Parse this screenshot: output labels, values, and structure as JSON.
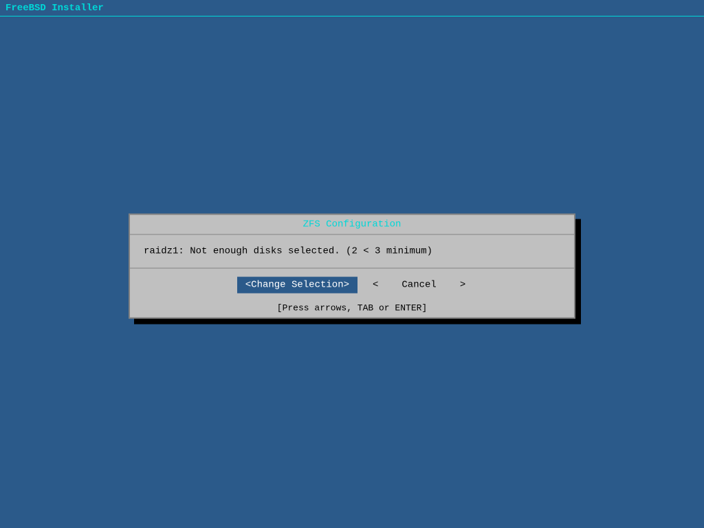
{
  "titlebar": {
    "label": "FreeBSD Installer"
  },
  "dialog": {
    "title": "ZFS Configuration",
    "message": "raidz1: Not enough disks selected. (2 < 3 minimum)",
    "btn_change_selection": "<Change Selection>",
    "btn_left_arrow": "<",
    "btn_cancel": "Cancel",
    "btn_right_arrow": ">",
    "hint": "[Press arrows, TAB or ENTER]"
  },
  "colors": {
    "background": "#2b5a8a",
    "title_color": "#00d7d7",
    "dialog_bg": "#c0c0c0",
    "selected_btn_bg": "#2b5a8a",
    "selected_btn_fg": "#ffffff"
  }
}
